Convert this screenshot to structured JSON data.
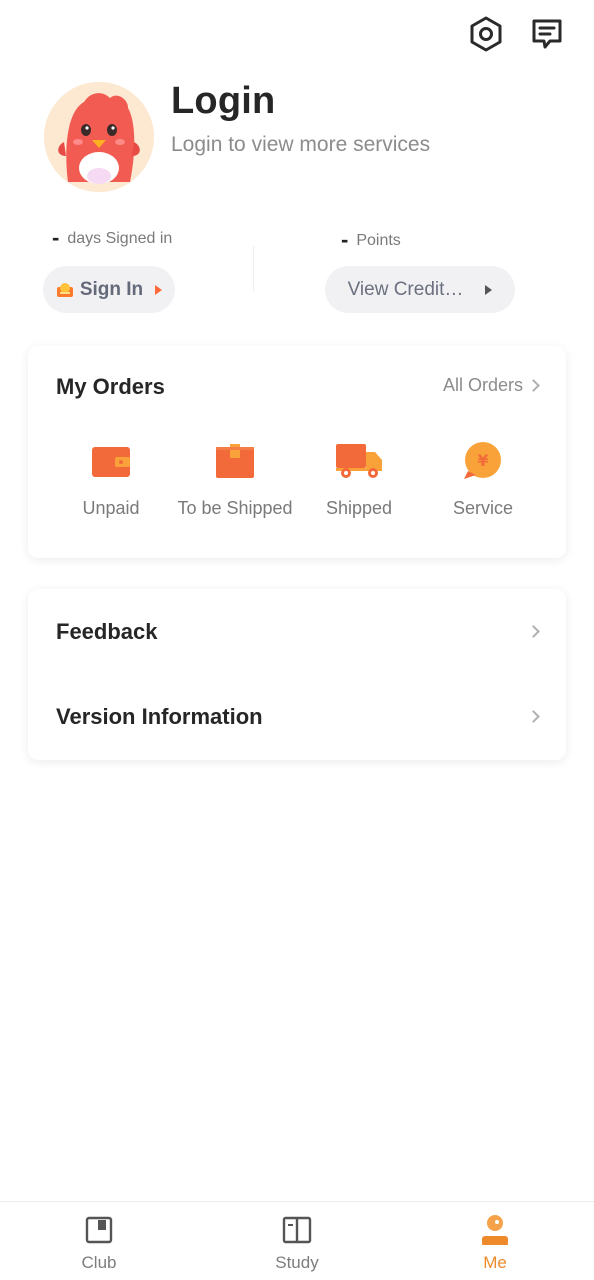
{
  "profile": {
    "title": "Login",
    "subtitle": "Login to view more services"
  },
  "stats": {
    "days_value": "-",
    "days_label": "days Signed in",
    "points_value": "-",
    "points_label": "Points",
    "signin_label": "Sign In",
    "credit_label": "View Credit…"
  },
  "orders": {
    "title": "My Orders",
    "all_label": "All Orders",
    "items": [
      {
        "label": "Unpaid",
        "icon": "wallet-icon"
      },
      {
        "label": "To be Shipped",
        "icon": "box-icon"
      },
      {
        "label": "Shipped",
        "icon": "truck-icon"
      },
      {
        "label": "Service",
        "icon": "yuan-service-icon"
      }
    ]
  },
  "menu": {
    "items": [
      {
        "label": "Feedback"
      },
      {
        "label": "Version Information"
      }
    ]
  },
  "nav": {
    "items": [
      {
        "label": "Club",
        "icon": "club-icon",
        "active": false
      },
      {
        "label": "Study",
        "icon": "book-icon",
        "active": false
      },
      {
        "label": "Me",
        "icon": "person-icon",
        "active": true
      }
    ]
  },
  "colors": {
    "accent": "#ee8a2a",
    "order_icon": "#f26a3a",
    "order_icon_light": "#f9a23a"
  }
}
